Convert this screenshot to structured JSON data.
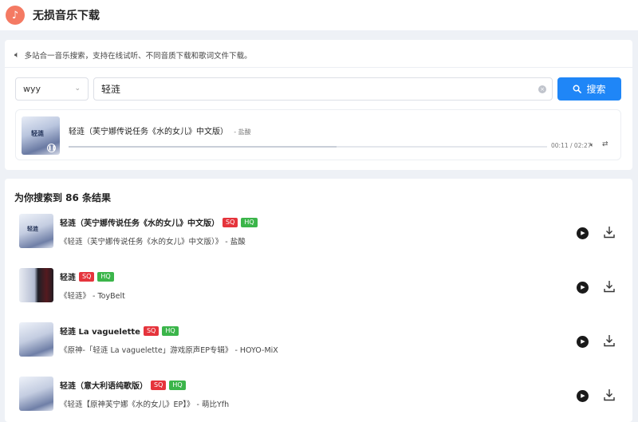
{
  "app": {
    "title": "无损音乐下载",
    "logo_icon": "music-note-icon",
    "accent": "#f47a63"
  },
  "notice": {
    "text": "多站合一音乐搜索，支持在线试听、不同音质下载和歌词文件下载。"
  },
  "search": {
    "source": "wyy",
    "query": "轻涟",
    "button_label": "搜索",
    "button_color": "#1f86f7"
  },
  "player": {
    "cover_text": "轻涟",
    "title": "轻涟（芙宁娜传说任务《水的女儿》中文版）",
    "artist": "- 盐酸",
    "time": "00:11 / 02:27",
    "progress": 0.56
  },
  "results": {
    "heading": "为你搜索到 86 条结果",
    "items": [
      {
        "name": "轻涟（芙宁娜传说任务《水的女儿》中文版）",
        "sq": "SQ",
        "hq": "HQ",
        "sub": "《轻涟（芙宁娜传说任务《水的女儿》中文版）》 - 盐酸",
        "cover_text": "轻涟",
        "dark": false
      },
      {
        "name": "轻涟",
        "sq": "SQ",
        "hq": "HQ",
        "sub": "《轻涟》 - ToyBelt",
        "cover_text": "",
        "dark": true
      },
      {
        "name": "轻涟 La vaguelette",
        "sq": "SQ",
        "hq": "HQ",
        "sub": "《原神-「轻涟 La vaguelette」游戏原声EP专辑》 - HOYO-MiX",
        "cover_text": "",
        "dark": false
      },
      {
        "name": "轻涟（意大利语纯歌版）",
        "sq": "SQ",
        "hq": "HQ",
        "sub": "《轻涟【原神芙宁娜《水的女儿》EP】》 - 萌比Yfh",
        "cover_text": "",
        "dark": false
      }
    ]
  }
}
